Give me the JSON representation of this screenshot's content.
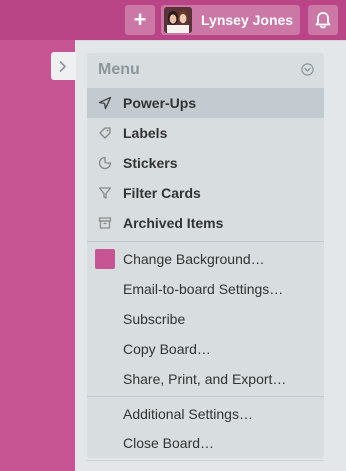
{
  "header": {
    "add_glyph": "+",
    "user_name": "Lynsey Jones"
  },
  "menu": {
    "title": "Menu",
    "primary_items": [
      {
        "label": "Power-Ups",
        "icon": "rocket-icon"
      },
      {
        "label": "Labels",
        "icon": "tag-icon"
      },
      {
        "label": "Stickers",
        "icon": "sticker-icon"
      },
      {
        "label": "Filter Cards",
        "icon": "filter-icon"
      },
      {
        "label": "Archived Items",
        "icon": "archive-icon"
      }
    ],
    "background_item": {
      "label": "Change Background…",
      "color": "#c75493"
    },
    "secondary_items": [
      {
        "label": "Email-to-board Settings…"
      },
      {
        "label": "Subscribe"
      },
      {
        "label": "Copy Board…"
      },
      {
        "label": "Share, Print, and Export…"
      }
    ],
    "tertiary_items": [
      {
        "label": "Additional Settings…"
      },
      {
        "label": "Close Board…"
      }
    ]
  },
  "colors": {
    "board_background": "#c75493",
    "header_bar": "#b94486",
    "menu_panel": "#d8dde0",
    "active_item": "#c4cbd0"
  }
}
